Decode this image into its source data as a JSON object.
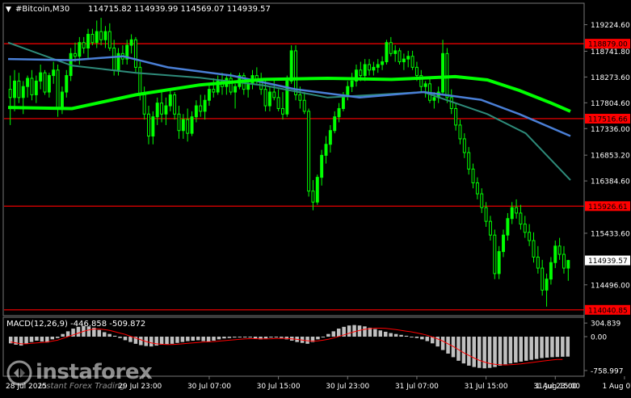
{
  "header": {
    "arrow": "▼",
    "symbol_info": "#Bitcoin,M30",
    "ohlc": "114715.82 114939.99 114569.07 114939.57"
  },
  "macd_label": "MACD(12,26,9) -446.858 -509.872",
  "colors": {
    "background": "#000000",
    "bull": "#00ff00",
    "bear": "#00ff00",
    "level_line": "#ff0000",
    "level_badge": "#ff0000",
    "ma_fast": "#00ff00",
    "ma_mid": "#4a7fd6",
    "ma_slow": "#2e8b7a",
    "histogram": "#c0c0c0",
    "signal": "#ff0000"
  },
  "chart_data": [
    {
      "type": "candlestick",
      "symbol": "#Bitcoin",
      "timeframe": "M30",
      "y_axis_ticks": [
        "119224.60",
        "118741.80",
        "118273.60",
        "117804.60",
        "117336.00",
        "116853.20",
        "116384.60",
        "115433.60",
        "114496.00"
      ],
      "y_ticks_values": [
        119224.6,
        118741.8,
        118273.6,
        117804.6,
        117336.0,
        116853.2,
        116384.6,
        115433.6,
        114496.0
      ],
      "ylim": [
        113950,
        119600
      ],
      "current_price": {
        "value": 114939.57,
        "label": "114939.57"
      },
      "levels": [
        {
          "value": 118879.0,
          "label": "118879.00"
        },
        {
          "value": 117516.66,
          "label": "117516.66"
        },
        {
          "value": 115926.61,
          "label": "115926.61"
        },
        {
          "value": 114040.85,
          "label": "114040.85"
        }
      ],
      "x_tick_labels": [
        "29 Jul 23:00",
        "30 Jul 07:00",
        "30 Jul 15:00",
        "30 Jul 23:00",
        "31 Jul 07:00",
        "31 Jul 15:00",
        "31 Jul 23:00",
        "1 Aug 07:00"
      ],
      "x_tick_index": [
        30,
        46,
        62,
        78,
        94,
        110,
        126,
        142
      ],
      "ma_fast": [
        [
          0,
          117720
        ],
        [
          20,
          117700
        ],
        [
          40,
          117950
        ],
        [
          60,
          118130
        ],
        [
          80,
          118230
        ],
        [
          100,
          118250
        ],
        [
          120,
          118230
        ],
        [
          140,
          118280
        ],
        [
          150,
          118220
        ],
        [
          160,
          118030
        ],
        [
          170,
          117800
        ],
        [
          176,
          117650
        ]
      ],
      "ma_mid": [
        [
          0,
          118600
        ],
        [
          20,
          118580
        ],
        [
          36,
          118650
        ],
        [
          50,
          118450
        ],
        [
          70,
          118300
        ],
        [
          90,
          118050
        ],
        [
          110,
          117900
        ],
        [
          130,
          118000
        ],
        [
          148,
          117860
        ],
        [
          160,
          117600
        ],
        [
          176,
          117200
        ]
      ],
      "ma_slow": [
        [
          0,
          118900
        ],
        [
          20,
          118480
        ],
        [
          40,
          118350
        ],
        [
          60,
          118260
        ],
        [
          80,
          118120
        ],
        [
          100,
          117900
        ],
        [
          130,
          118000
        ],
        [
          150,
          117600
        ],
        [
          162,
          117250
        ],
        [
          176,
          116400
        ]
      ],
      "candles": [
        [
          118050,
          118300,
          117400,
          117900
        ],
        [
          117900,
          118400,
          117650,
          118200
        ],
        [
          118200,
          118350,
          117800,
          117900
        ],
        [
          117900,
          118200,
          117600,
          118100
        ],
        [
          118100,
          118300,
          117900,
          118250
        ],
        [
          118250,
          118400,
          117850,
          117950
        ],
        [
          117950,
          118300,
          117800,
          118200
        ],
        [
          118200,
          118500,
          118050,
          118350
        ],
        [
          118350,
          118400,
          117950,
          118000
        ],
        [
          118000,
          118350,
          117900,
          118300
        ],
        [
          118300,
          118550,
          118150,
          118400
        ],
        [
          118400,
          118500,
          117550,
          117700
        ],
        [
          117700,
          118100,
          117600,
          118000
        ],
        [
          118000,
          118400,
          117900,
          118300
        ],
        [
          118300,
          118800,
          118200,
          118700
        ],
        [
          118700,
          118900,
          118550,
          118650
        ],
        [
          118650,
          119000,
          118500,
          118900
        ],
        [
          118900,
          119000,
          118700,
          118800
        ],
        [
          118800,
          119150,
          118600,
          119050
        ],
        [
          119050,
          119150,
          118850,
          118900
        ],
        [
          118900,
          119300,
          118800,
          119100
        ],
        [
          119100,
          119350,
          118850,
          118950
        ],
        [
          118950,
          119200,
          118800,
          119100
        ],
        [
          119100,
          119250,
          118750,
          118800
        ],
        [
          118800,
          118950,
          118300,
          118400
        ],
        [
          118400,
          118800,
          118300,
          118700
        ],
        [
          118700,
          118850,
          118500,
          118600
        ],
        [
          118600,
          118950,
          118500,
          118850
        ],
        [
          118850,
          119050,
          118700,
          118950
        ],
        [
          118950,
          119000,
          118350,
          118450
        ],
        [
          118450,
          118550,
          117850,
          117950
        ],
        [
          117950,
          118100,
          117500,
          117600
        ],
        [
          117600,
          117750,
          117050,
          117200
        ],
        [
          117200,
          117650,
          117050,
          117550
        ],
        [
          117550,
          117900,
          117400,
          117800
        ],
        [
          117800,
          118000,
          117450,
          117600
        ],
        [
          117600,
          117900,
          117400,
          117750
        ],
        [
          117750,
          118050,
          117650,
          117950
        ],
        [
          117950,
          118000,
          117500,
          117600
        ],
        [
          117600,
          117750,
          117150,
          117300
        ],
        [
          117300,
          117600,
          117150,
          117500
        ],
        [
          117500,
          117700,
          117100,
          117250
        ],
        [
          117250,
          117650,
          117200,
          117550
        ],
        [
          117550,
          117850,
          117450,
          117750
        ],
        [
          117750,
          117950,
          117550,
          117650
        ],
        [
          117650,
          117950,
          117500,
          117850
        ],
        [
          117850,
          118150,
          117750,
          118050
        ],
        [
          118050,
          118250,
          117900,
          118000
        ],
        [
          118000,
          118300,
          117950,
          118200
        ],
        [
          118200,
          118350,
          117950,
          118100
        ],
        [
          118100,
          118300,
          117950,
          118250
        ],
        [
          118250,
          118350,
          117950,
          118000
        ],
        [
          118000,
          118150,
          117700,
          118100
        ],
        [
          118100,
          118350,
          118050,
          118300
        ],
        [
          118300,
          118350,
          117950,
          118050
        ],
        [
          118050,
          118250,
          117900,
          118150
        ],
        [
          118150,
          118400,
          118050,
          118300
        ],
        [
          118300,
          118450,
          118150,
          118200
        ],
        [
          118200,
          118350,
          117950,
          118050
        ],
        [
          118050,
          118200,
          117650,
          117750
        ],
        [
          117750,
          118100,
          117650,
          118000
        ],
        [
          118000,
          118250,
          117850,
          117900
        ],
        [
          117900,
          118050,
          117650,
          117700
        ],
        [
          117700,
          118000,
          117500,
          117600
        ],
        [
          117600,
          118300,
          117550,
          118200
        ],
        [
          118200,
          118850,
          118150,
          118750
        ],
        [
          118750,
          118850,
          117850,
          117950
        ],
        [
          117950,
          118100,
          117700,
          117850
        ],
        [
          117850,
          118000,
          117600,
          117650
        ],
        [
          117650,
          117700,
          116100,
          116200
        ],
        [
          116200,
          116400,
          115850,
          116000
        ],
        [
          116000,
          116500,
          115950,
          116450
        ],
        [
          116450,
          116950,
          116300,
          116850
        ],
        [
          116850,
          117200,
          116700,
          117050
        ],
        [
          117050,
          117400,
          116900,
          117300
        ],
        [
          117300,
          117650,
          117250,
          117550
        ],
        [
          117550,
          117800,
          117450,
          117700
        ],
        [
          117700,
          118000,
          117650,
          117950
        ],
        [
          117950,
          118200,
          117850,
          118100
        ],
        [
          118100,
          118350,
          118000,
          118200
        ],
        [
          118200,
          118500,
          118100,
          118400
        ],
        [
          118400,
          118550,
          118200,
          118300
        ],
        [
          118300,
          118600,
          118200,
          118500
        ],
        [
          118500,
          118600,
          118300,
          118400
        ],
        [
          118400,
          118550,
          118300,
          118450
        ],
        [
          118450,
          118600,
          118350,
          118500
        ],
        [
          118500,
          118650,
          118400,
          118550
        ],
        [
          118550,
          118950,
          118500,
          118900
        ],
        [
          118900,
          119000,
          118650,
          118700
        ],
        [
          118700,
          118850,
          118550,
          118750
        ],
        [
          118750,
          118800,
          118500,
          118550
        ],
        [
          118550,
          118700,
          118400,
          118600
        ],
        [
          118600,
          118750,
          118450,
          118650
        ],
        [
          118650,
          118750,
          118400,
          118450
        ],
        [
          118450,
          118550,
          118200,
          118300
        ],
        [
          118300,
          118400,
          118000,
          118100
        ],
        [
          118100,
          118200,
          117900,
          118150
        ],
        [
          118150,
          118250,
          117800,
          117850
        ],
        [
          117850,
          118000,
          117700,
          117900
        ],
        [
          117900,
          118100,
          117800,
          118000
        ],
        [
          118000,
          118950,
          117950,
          118700
        ],
        [
          118700,
          118800,
          117800,
          117900
        ],
        [
          117900,
          118050,
          117600,
          117700
        ],
        [
          117700,
          117800,
          117300,
          117400
        ],
        [
          117400,
          117500,
          117050,
          117150
        ],
        [
          117150,
          117250,
          116800,
          116900
        ],
        [
          116900,
          117000,
          116500,
          116600
        ],
        [
          116600,
          116700,
          116250,
          116350
        ],
        [
          116350,
          116450,
          116050,
          116150
        ],
        [
          116150,
          116250,
          115800,
          115900
        ],
        [
          115900,
          116000,
          115550,
          115650
        ],
        [
          115650,
          115750,
          115300,
          115400
        ],
        [
          115400,
          115500,
          114600,
          114700
        ],
        [
          114700,
          115200,
          114600,
          115100
        ],
        [
          115100,
          115500,
          115000,
          115400
        ],
        [
          115400,
          115800,
          115300,
          115700
        ],
        [
          115700,
          116000,
          115600,
          115900
        ],
        [
          115900,
          116050,
          115700,
          115800
        ],
        [
          115800,
          115950,
          115500,
          115600
        ],
        [
          115600,
          115750,
          115350,
          115450
        ],
        [
          115450,
          115600,
          115200,
          115300
        ],
        [
          115300,
          115450,
          114900,
          115000
        ],
        [
          115000,
          115200,
          114700,
          114800
        ],
        [
          114800,
          114950,
          114300,
          114400
        ],
        [
          114400,
          114700,
          114100,
          114600
        ],
        [
          114600,
          115000,
          114500,
          114900
        ],
        [
          114900,
          115300,
          114800,
          115200
        ],
        [
          115200,
          115350,
          114950,
          115050
        ],
        [
          115050,
          115200,
          114700,
          114800
        ],
        [
          114800,
          114950,
          114569,
          114939
        ]
      ]
    },
    {
      "type": "bar",
      "name": "MACD(12,26,9)",
      "y_axis_ticks": [
        "304.839",
        "0.00",
        "-758.997"
      ],
      "y_ticks_values": [
        304.839,
        0,
        -758.997
      ],
      "ylim": [
        -850,
        380
      ],
      "macd": -446.858,
      "signal": -509.872,
      "histogram": [
        -150,
        -180,
        -200,
        -160,
        -120,
        -90,
        -110,
        -130,
        -60,
        -30,
        60,
        120,
        180,
        220,
        240,
        230,
        200,
        150,
        100,
        60,
        20,
        -30,
        -80,
        -120,
        -160,
        -190,
        -210,
        -220,
        -200,
        -180,
        -170,
        -160,
        -140,
        -120,
        -100,
        -90,
        -80,
        -100,
        -110,
        -90,
        -60,
        -40,
        -30,
        -20,
        -10,
        0,
        -20,
        -40,
        -60,
        -40,
        -20,
        -10,
        -30,
        -60,
        -90,
        -120,
        -140,
        -160,
        -120,
        -60,
        0,
        60,
        120,
        180,
        220,
        250,
        260,
        250,
        230,
        200,
        170,
        140,
        110,
        80,
        60,
        40,
        20,
        0,
        -30,
        -60,
        -100,
        -150,
        -220,
        -300,
        -380,
        -460,
        -540,
        -600,
        -650,
        -680,
        -700,
        -710,
        -700,
        -680,
        -650,
        -620,
        -600,
        -580,
        -560,
        -540,
        -520,
        -500,
        -480,
        -470,
        -460,
        -455,
        -450,
        -447
      ],
      "signal_line": [
        -120,
        -140,
        -160,
        -160,
        -150,
        -140,
        -130,
        -120,
        -100,
        -80,
        -40,
        0,
        40,
        80,
        120,
        150,
        170,
        170,
        160,
        140,
        110,
        80,
        50,
        10,
        -30,
        -70,
        -110,
        -140,
        -160,
        -170,
        -175,
        -175,
        -170,
        -160,
        -150,
        -140,
        -130,
        -120,
        -115,
        -110,
        -100,
        -90,
        -80,
        -70,
        -60,
        -50,
        -45,
        -45,
        -48,
        -48,
        -46,
        -42,
        -40,
        -42,
        -50,
        -62,
        -76,
        -92,
        -100,
        -95,
        -80,
        -58,
        -30,
        4,
        40,
        76,
        110,
        140,
        164,
        180,
        190,
        190,
        184,
        172,
        158,
        142,
        124,
        106,
        84,
        60,
        30,
        -8,
        -50,
        -100,
        -160,
        -220,
        -290,
        -360,
        -420,
        -480,
        -530,
        -570,
        -600,
        -620,
        -630,
        -635,
        -630,
        -620,
        -610,
        -595,
        -580,
        -565,
        -550,
        -535,
        -522,
        -512,
        -510
      ]
    }
  ],
  "x_axis": {
    "first_label": "28 Jul 2025",
    "last_label": "1 Aug 15:00"
  },
  "watermark": {
    "name": "instaforex",
    "tagline": "Instant Forex Trading"
  }
}
